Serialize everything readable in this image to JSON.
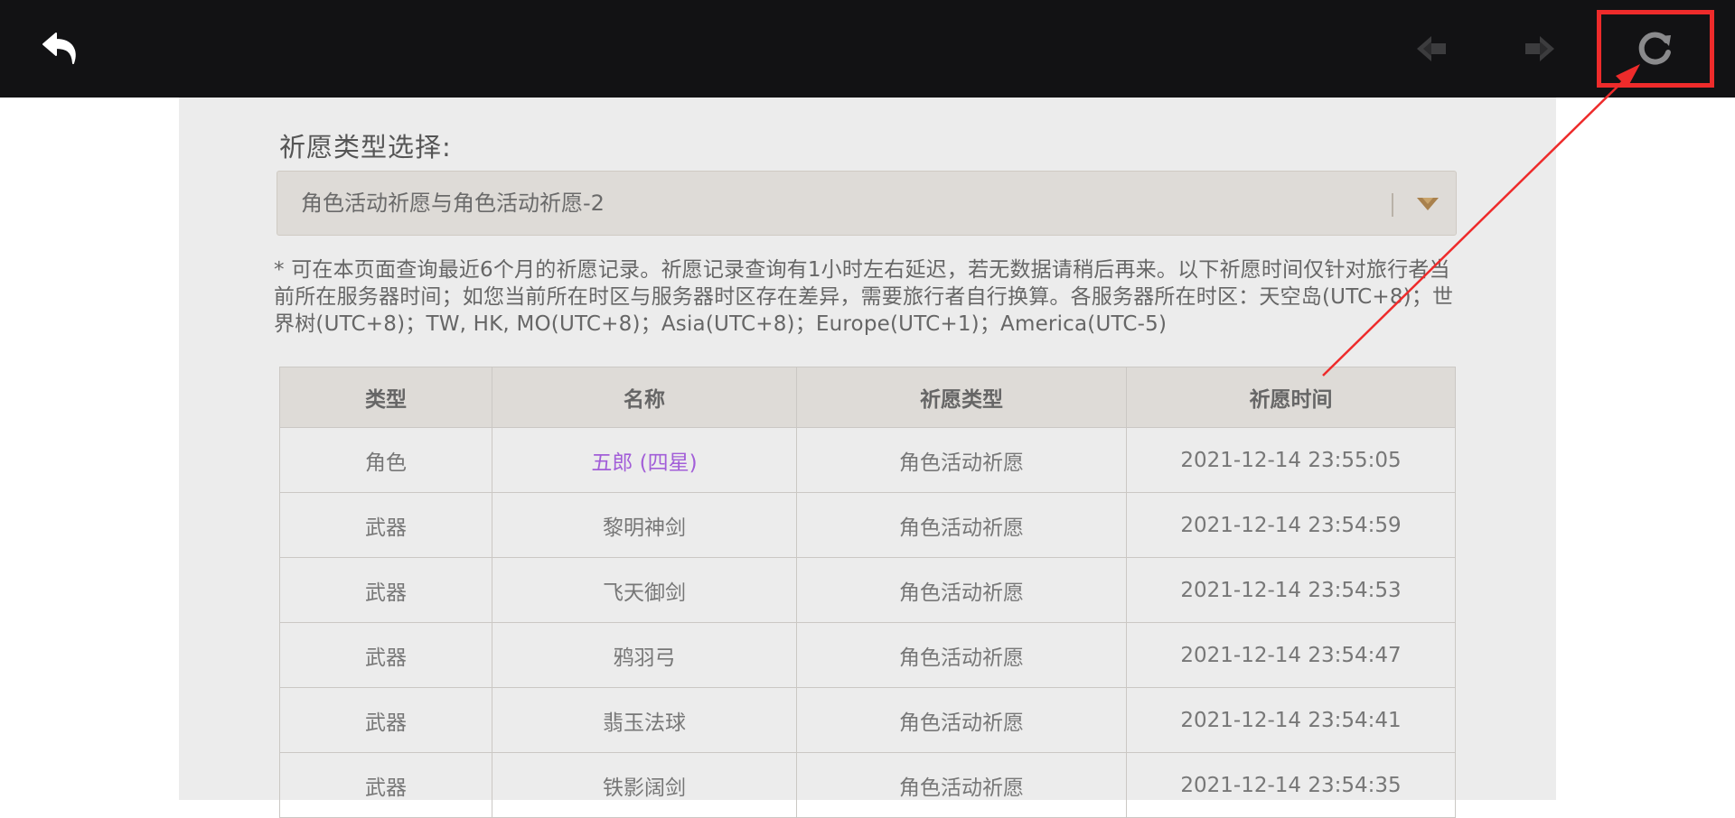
{
  "toolbar": {
    "back_icon": "back-arrow-icon",
    "prev_icon": "prev-arrow-icon",
    "next_icon": "next-arrow-icon",
    "refresh_icon": "refresh-icon"
  },
  "wish_type": {
    "label": "祈愿类型选择:",
    "selected": "角色活动祈愿与角色活动祈愿-2",
    "dropdown_icon": "chevron-down-icon"
  },
  "notice": "* 可在本页面查询最近6个月的祈愿记录。祈愿记录查询有1小时左右延迟，若无数据请稍后再来。以下祈愿时间仅针对旅行者当前所在服务器时间；如您当前所在时区与服务器时区存在差异，需要旅行者自行换算。各服务器所在时区：天空岛(UTC+8)；世界树(UTC+8)；TW, HK, MO(UTC+8)；Asia(UTC+8)；Europe(UTC+1)；America(UTC-5)",
  "table": {
    "headers": [
      "类型",
      "名称",
      "祈愿类型",
      "祈愿时间"
    ],
    "rows": [
      [
        "角色",
        "五郎 (四星)",
        "角色活动祈愿",
        "2021-12-14 23:55:05"
      ],
      [
        "武器",
        "黎明神剑",
        "角色活动祈愿",
        "2021-12-14 23:54:59"
      ],
      [
        "武器",
        "飞天御剑",
        "角色活动祈愿",
        "2021-12-14 23:54:53"
      ],
      [
        "武器",
        "鸦羽弓",
        "角色活动祈愿",
        "2021-12-14 23:54:47"
      ],
      [
        "武器",
        "翡玉法球",
        "角色活动祈愿",
        "2021-12-14 23:54:41"
      ],
      [
        "武器",
        "铁影阔剑",
        "角色活动祈愿",
        "2021-12-14 23:54:35"
      ]
    ]
  },
  "colors": {
    "topbar": "#121214",
    "panel": "#ececec",
    "four_star": "#a25ed8",
    "annotation": "#ee2b2b"
  }
}
